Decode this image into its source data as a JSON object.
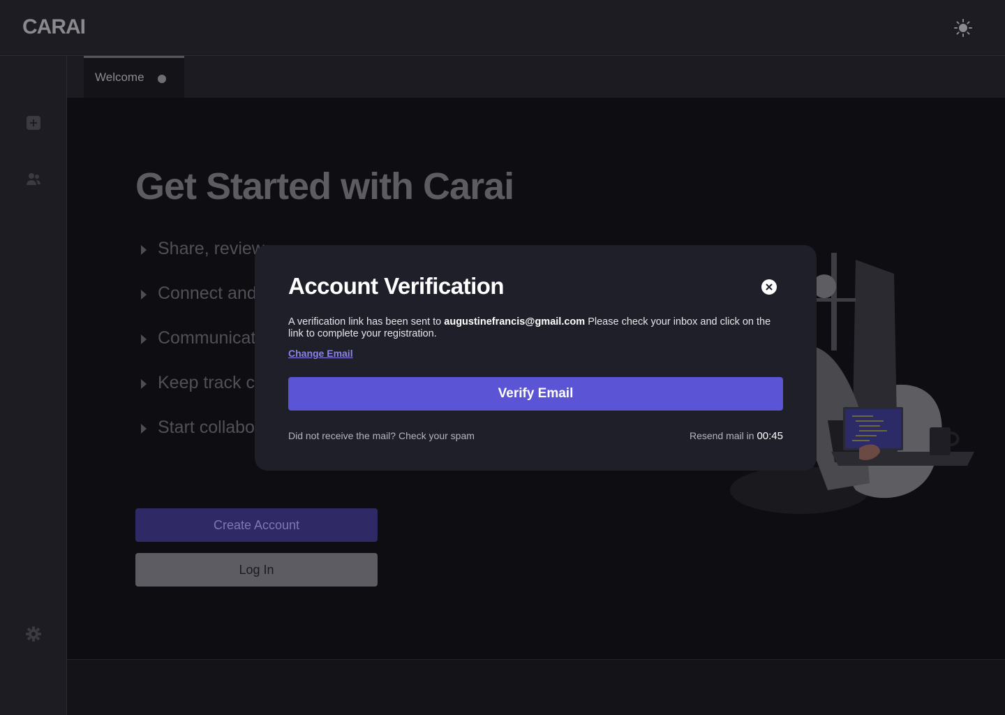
{
  "header": {
    "logo": "CARAI",
    "theme_icon": "sun-icon"
  },
  "sidebar": {
    "items": [
      {
        "icon": "add-square-icon"
      },
      {
        "icon": "users-icon"
      }
    ],
    "bottom_icon": "gear-icon"
  },
  "tabs": [
    {
      "label": "Welcome",
      "indicator": "dot"
    }
  ],
  "main": {
    "title": "Get Started with Carai",
    "bullets": [
      "Share, review",
      "Connect and",
      "Communicat",
      "Keep track c",
      "Start collabo"
    ],
    "create_account_label": "Create Account",
    "login_label": "Log In"
  },
  "modal": {
    "title": "Account Verification",
    "text_before": "A verification link has been sent to ",
    "email": "augustinefrancis@gmail.com",
    "text_after": " Please check your inbox and click on the link to complete your registration.",
    "change_email_label": "Change Email",
    "verify_label": "Verify Email",
    "spam_text": "Did not receive the mail? Check your spam",
    "resend_text": "Resend mail in ",
    "timer": "00:45"
  },
  "colors": {
    "accent": "#5b55d6",
    "link": "#8b83e6",
    "modal_bg": "#1f1f29",
    "page_bg": "#0e0e12"
  }
}
